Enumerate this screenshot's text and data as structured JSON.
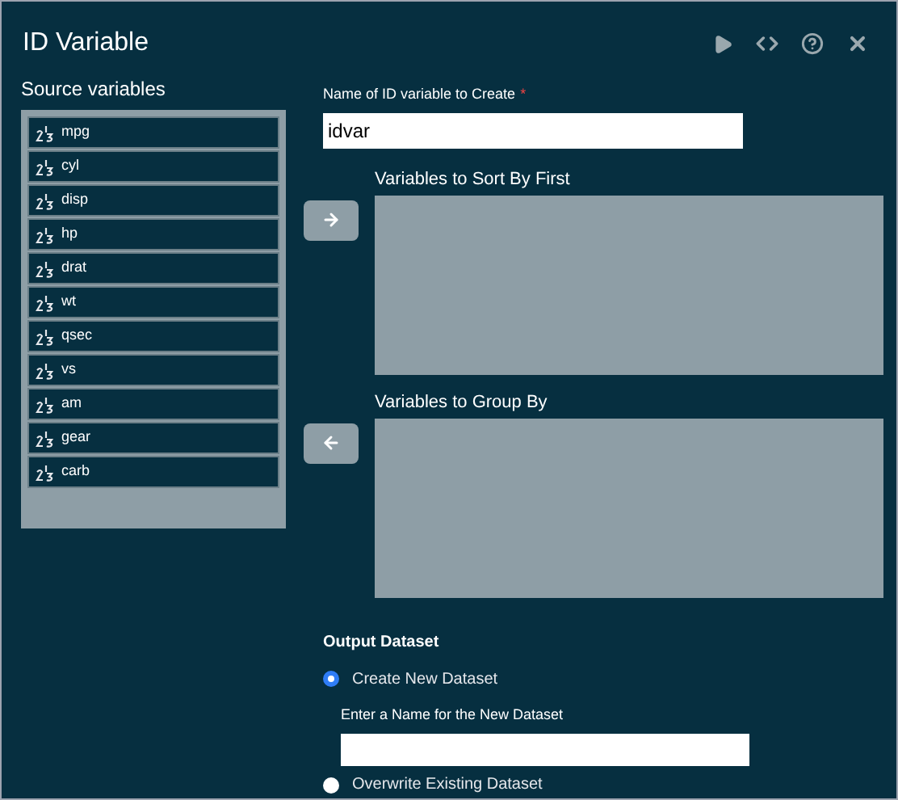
{
  "window": {
    "title": "ID Variable"
  },
  "source": {
    "label": "Source variables",
    "items": [
      {
        "name": "mpg"
      },
      {
        "name": "cyl"
      },
      {
        "name": "disp"
      },
      {
        "name": "hp"
      },
      {
        "name": "drat"
      },
      {
        "name": "wt"
      },
      {
        "name": "qsec"
      },
      {
        "name": "vs"
      },
      {
        "name": "am"
      },
      {
        "name": "gear"
      },
      {
        "name": "carb"
      }
    ]
  },
  "id_name": {
    "label": "Name of ID variable to Create",
    "required_mark": "*",
    "value": "idvar"
  },
  "sort_by": {
    "label": "Variables to Sort By First"
  },
  "group_by": {
    "label": "Variables to Group By"
  },
  "output": {
    "label": "Output Dataset",
    "options": [
      {
        "label": "Create New Dataset",
        "selected": true
      },
      {
        "label": "Overwrite Existing Dataset",
        "selected": false
      }
    ],
    "name_label": "Enter a Name for the New Dataset"
  }
}
